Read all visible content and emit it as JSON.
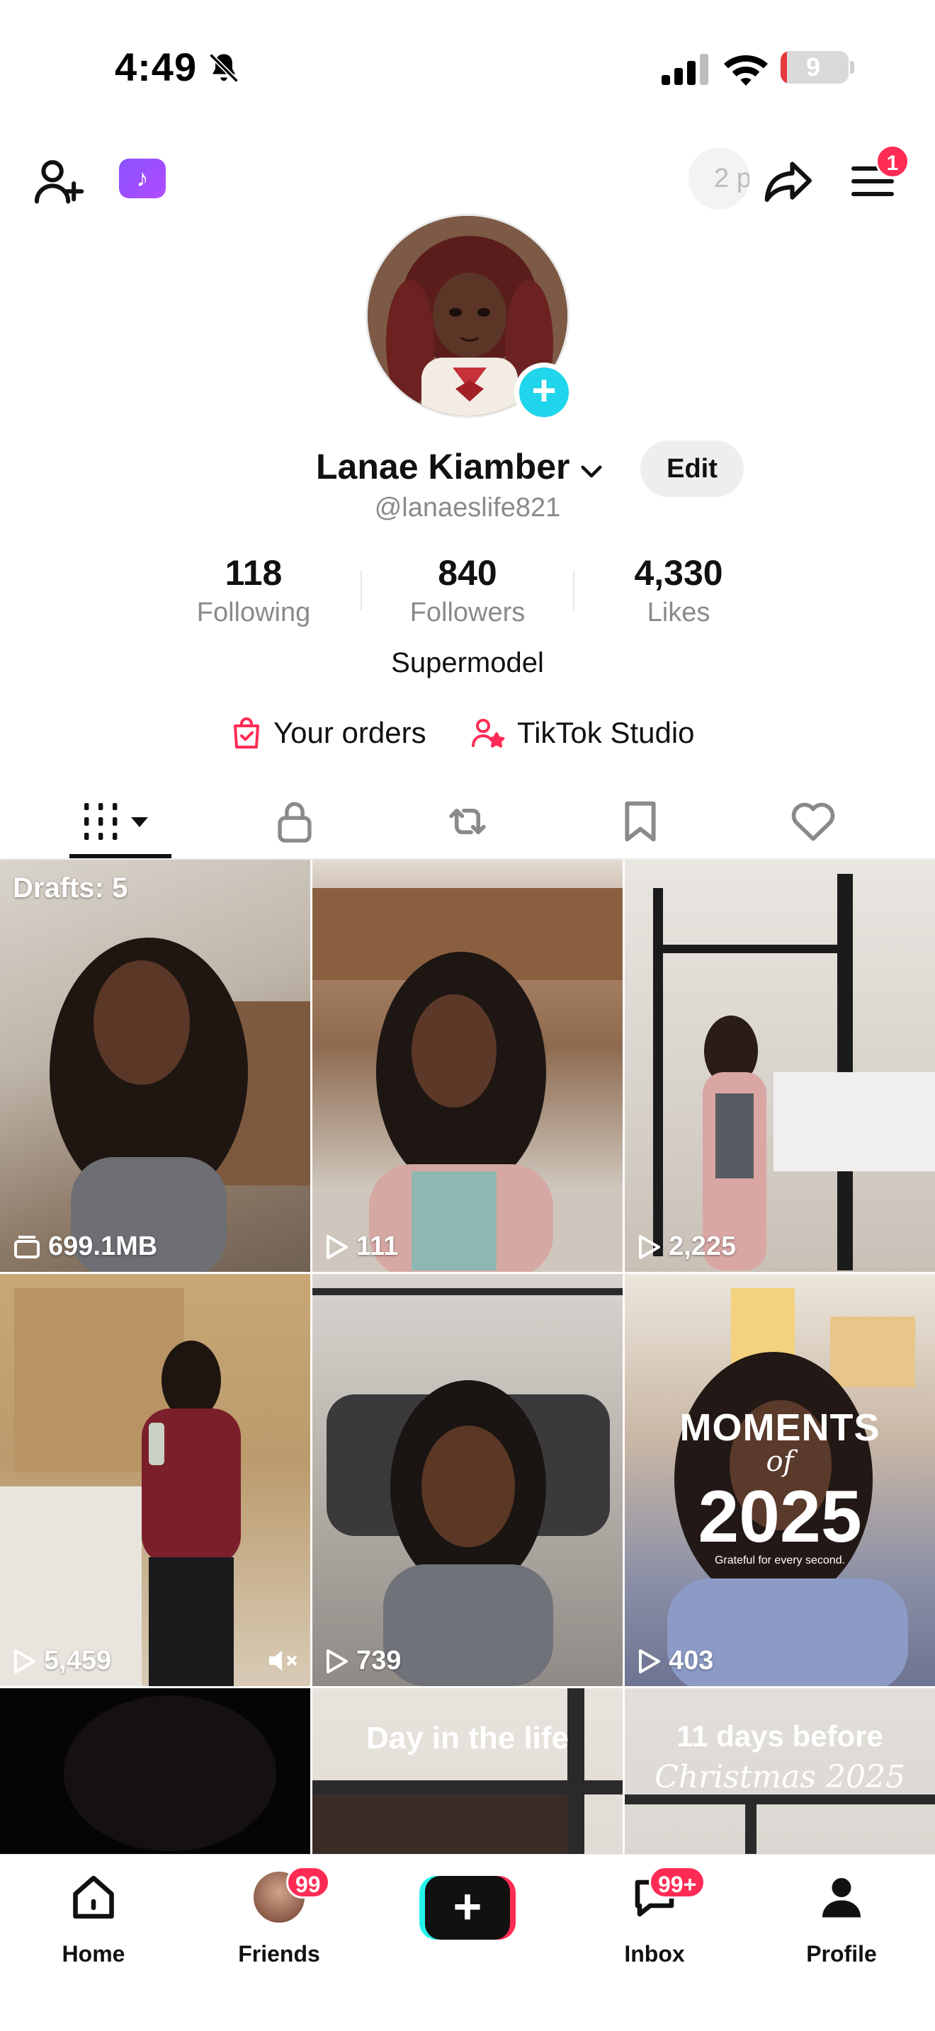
{
  "status_bar": {
    "time": "4:49",
    "battery": "9",
    "battery_level": 0.09
  },
  "header": {
    "now_pill_text": "2 p",
    "menu_badge": "1"
  },
  "profile": {
    "display_name": "Lanae Kiamber",
    "username": "@lanaeslife821",
    "edit_label": "Edit",
    "bio": "Supermodel",
    "stats": [
      {
        "value": "118",
        "label": "Following"
      },
      {
        "value": "840",
        "label": "Followers"
      },
      {
        "value": "4,330",
        "label": "Likes"
      }
    ],
    "links": [
      {
        "label": "Your orders"
      },
      {
        "label": "TikTok Studio"
      }
    ]
  },
  "tabs": [
    {
      "name": "videos",
      "icon": "videos-grid-icon",
      "active": true
    },
    {
      "name": "private",
      "icon": "lock-icon",
      "active": false
    },
    {
      "name": "reposts",
      "icon": "repost-icon",
      "active": false
    },
    {
      "name": "favorites",
      "icon": "bookmark-icon",
      "active": false
    },
    {
      "name": "liked",
      "icon": "heart-icon",
      "active": false
    }
  ],
  "grid": {
    "drafts_label": "Drafts: 5",
    "tiles": [
      {
        "caption": "699.1MB",
        "kind": "drafts"
      },
      {
        "caption": "111",
        "kind": "views"
      },
      {
        "caption": "2,225",
        "kind": "views"
      },
      {
        "caption": "5,459",
        "kind": "views"
      },
      {
        "caption": "739",
        "kind": "views"
      },
      {
        "caption": "403",
        "kind": "views"
      },
      {
        "caption": "",
        "kind": "partial"
      },
      {
        "caption": "",
        "kind": "partial"
      },
      {
        "caption": "",
        "kind": "partial"
      }
    ],
    "overlay_moments": {
      "line1": "MOMENTS",
      "line2": "of",
      "line3": "2025",
      "line4": "Grateful for every second."
    },
    "overlay_day": "Day in the life",
    "overlay_days": {
      "line1": "11 days before",
      "line2": "Christmas 2025"
    }
  },
  "bottom_nav": {
    "home": "Home",
    "friends": "Friends",
    "friends_badge": "99",
    "inbox": "Inbox",
    "inbox_badge": "99+",
    "profile": "Profile"
  },
  "colors": {
    "accent": "#fe2c55",
    "cyan": "#25f4ee",
    "avatar_add": "#20d5ec",
    "muted_text": "#8a8a8a"
  }
}
